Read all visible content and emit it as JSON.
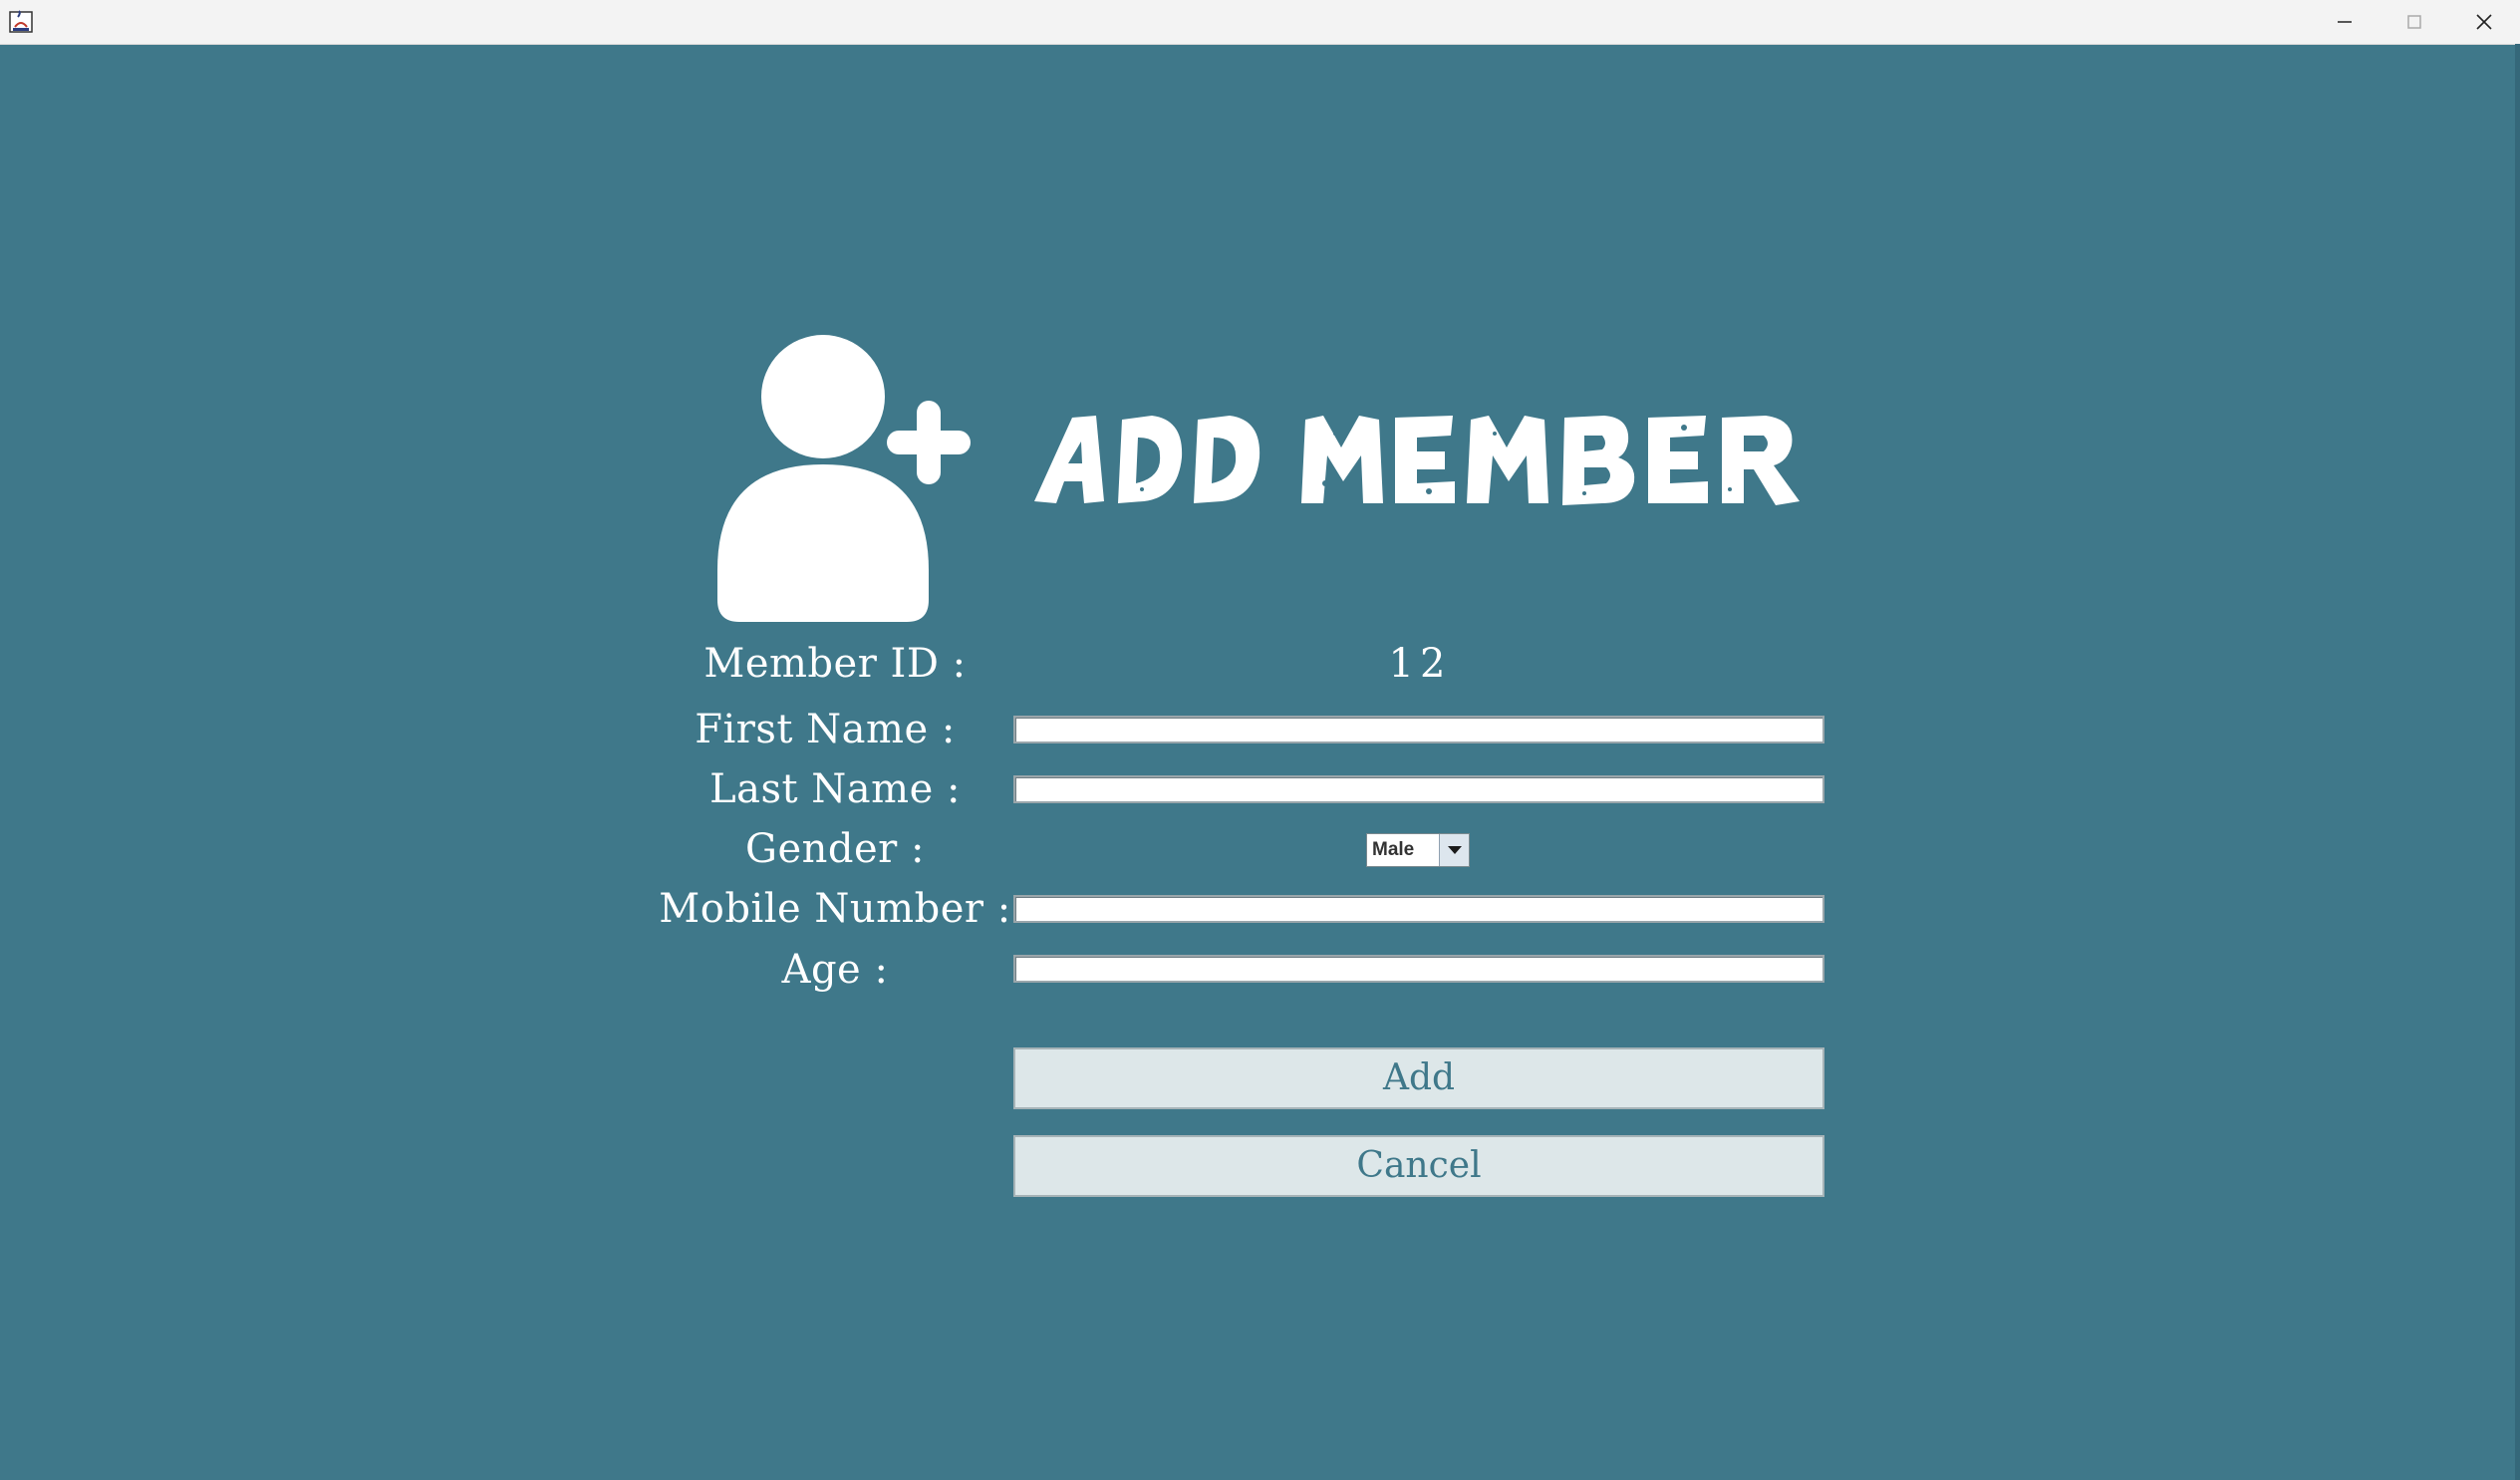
{
  "window": {
    "background_color": "#3f788a",
    "controls": {
      "minimize_icon": "minimize-icon",
      "maximize_icon": "maximize-icon",
      "close_icon": "close-icon"
    }
  },
  "header": {
    "title": "ADD MEMBER",
    "icon": "add-user-icon"
  },
  "form": {
    "member_id": {
      "label": "Member ID :",
      "value": "12"
    },
    "first_name": {
      "label": "First Name :",
      "value": ""
    },
    "last_name": {
      "label": "Last Name :",
      "value": ""
    },
    "gender": {
      "label": "Gender :",
      "selected": "Male"
    },
    "mobile": {
      "label": "Mobile Number :",
      "value": ""
    },
    "age": {
      "label": "Age :",
      "value": ""
    }
  },
  "buttons": {
    "add": "Add",
    "cancel": "Cancel"
  }
}
